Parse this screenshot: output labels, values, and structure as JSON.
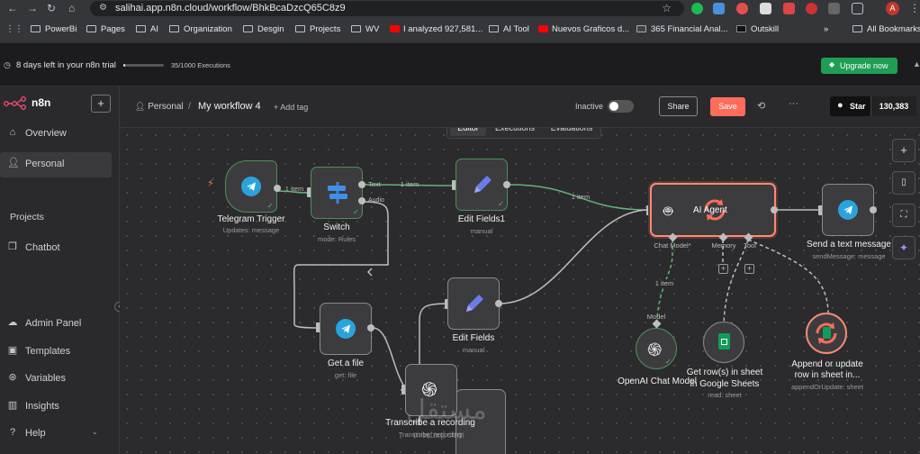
{
  "browser": {
    "url": "salihai.app.n8n.cloud/workflow/BhkBcaDzcQ65C8z9",
    "profile_initial": "A",
    "bookmarks": [
      "PowerBi",
      "Pages",
      "AI",
      "Organization",
      "Desgin",
      "Projects",
      "WV",
      "I analyzed 927,581...",
      "AI Tool",
      "Nuevos Graficos d...",
      "365 Financial Anal...",
      "Outskill"
    ],
    "more_bookmarks": "»",
    "all_bookmarks": "All Bookmarks"
  },
  "trial": {
    "text": "8 days left in your n8n trial",
    "executions": "35/1000 Executions",
    "executions_fraction": 0.035,
    "upgrade_label": "Upgrade now"
  },
  "sidebar": {
    "logo": "n8n",
    "add": "+",
    "items": [
      {
        "label": "Overview",
        "icon": "home-icon"
      },
      {
        "label": "Personal",
        "icon": "user-icon"
      }
    ],
    "projects_heading": "Projects",
    "chatbot": "Chatbot",
    "bottom": [
      {
        "label": "Admin Panel",
        "icon": "cloud-icon"
      },
      {
        "label": "Templates",
        "icon": "box-icon"
      },
      {
        "label": "Variables",
        "icon": "variables-icon"
      },
      {
        "label": "Insights",
        "icon": "insights-icon"
      },
      {
        "label": "Help",
        "icon": "help-icon"
      }
    ]
  },
  "header": {
    "breadcrumb_project": "Personal",
    "separator": "/",
    "workflow_name": "My workflow 4",
    "add_tag": "+ Add tag",
    "status": "Inactive",
    "share": "Share",
    "save": "Save",
    "more": "···",
    "star": "Star",
    "star_count": "130,383"
  },
  "tabs": [
    "Editor",
    "Executions",
    "Evaluations"
  ],
  "nodes": {
    "telegram_trigger": {
      "title": "Telegram Trigger",
      "sub": "Updates: message"
    },
    "switch": {
      "title": "Switch",
      "sub": "mode: Rules"
    },
    "edit_fields1": {
      "title": "Edit Fields1",
      "sub": "manual"
    },
    "ai_agent": {
      "title": "AI Agent",
      "ports": [
        "Chat Model*",
        "Memory",
        "Tool"
      ]
    },
    "send_text": {
      "title": "Send a text message",
      "sub": "sendMessage: message"
    },
    "get_file": {
      "title": "Get a file",
      "sub": "get: file"
    },
    "edit_fields": {
      "title": "Edit Fields",
      "sub": "manual"
    },
    "transcribe": {
      "title": "Transcribe a recording",
      "sub": "Transcribe: recording"
    },
    "openai_model": {
      "title": "OpenAI Chat Model",
      "port": "Model"
    },
    "get_rows": {
      "title": "Get row(s) in sheet in Google Sheets",
      "title1": "Get row(s) in sheet",
      "title2": "in Google Sheets",
      "sub": "read: sheet"
    },
    "append_update": {
      "title1": "Append or update",
      "title2": "row in sheet in...",
      "sub": "appendOrUpdate: sheet"
    }
  },
  "edges": {
    "one_item": "1 item",
    "text": "Text",
    "audio": "Audio"
  },
  "watermark": {
    "arabic": "مستقل",
    "latin": "mostaql.com"
  },
  "colors": {
    "accent": "#ff6d5a",
    "upgrade": "#1f9d55",
    "telegram": "#2aa3dd",
    "success": "#4c8f5c"
  }
}
